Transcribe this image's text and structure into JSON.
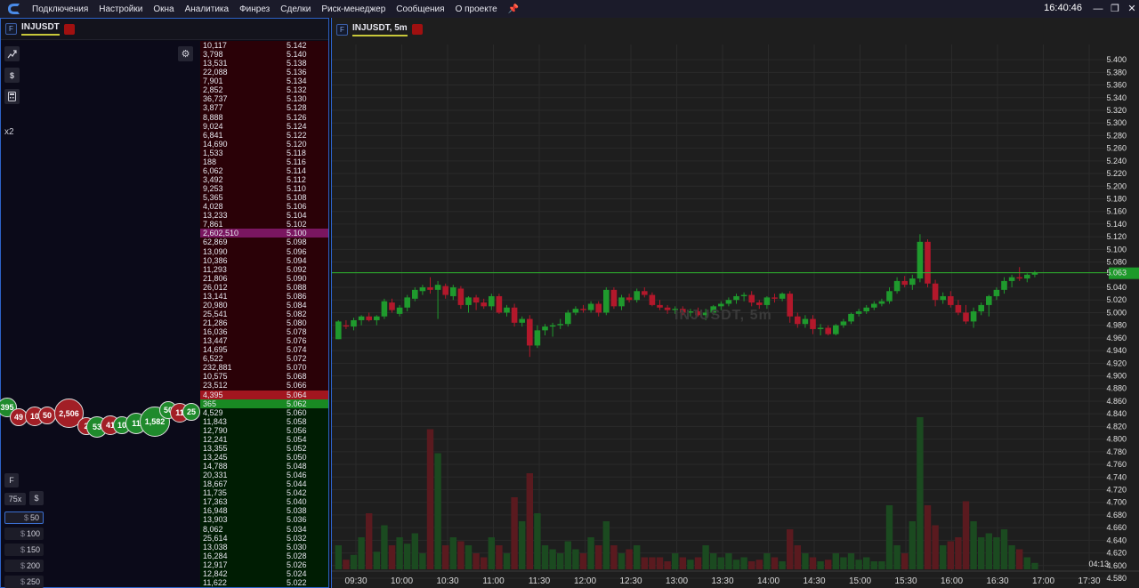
{
  "menubar": {
    "items": [
      "Подключения",
      "Настройки",
      "Окна",
      "Аналитика",
      "Финрез",
      "Сделки",
      "Риск-менеджер",
      "Сообщения",
      "О проекте"
    ],
    "clock": "16:40:46"
  },
  "left_panel": {
    "badge": "F",
    "symbol": "INJUSDT",
    "multiplier": "x2",
    "tools": [
      "chart-icon",
      "dollar-icon",
      "calculator-icon"
    ],
    "bubbles": [
      {
        "label": "395",
        "side": "buy"
      },
      {
        "label": "49",
        "side": "sell"
      },
      {
        "label": "10",
        "side": "sell"
      },
      {
        "label": "50",
        "side": "sell"
      },
      {
        "label": "2,506",
        "side": "sell"
      },
      {
        "label": "2",
        "side": "sell"
      },
      {
        "label": "53",
        "side": "buy"
      },
      {
        "label": "41",
        "side": "sell"
      },
      {
        "label": "10",
        "side": "buy"
      },
      {
        "label": "11",
        "side": "buy"
      },
      {
        "label": "1,582",
        "side": "buy"
      },
      {
        "label": "50",
        "side": "buy"
      },
      {
        "label": "11",
        "side": "sell"
      },
      {
        "label": "25",
        "side": "buy"
      }
    ],
    "bottom": {
      "f_label": "F",
      "leverage": "75x",
      "currency": "$",
      "amounts": [
        "50",
        "100",
        "150",
        "200",
        "250"
      ],
      "selected_amount": "50"
    }
  },
  "order_book": {
    "rows": [
      {
        "vol": "10,117",
        "price": "5.142",
        "side": "ask"
      },
      {
        "vol": "3,798",
        "price": "5.140",
        "side": "ask"
      },
      {
        "vol": "13,531",
        "price": "5.138",
        "side": "ask"
      },
      {
        "vol": "22,088",
        "price": "5.136",
        "side": "ask"
      },
      {
        "vol": "7,901",
        "price": "5.134",
        "side": "ask"
      },
      {
        "vol": "2,852",
        "price": "5.132",
        "side": "ask"
      },
      {
        "vol": "36,737",
        "price": "5.130",
        "side": "ask"
      },
      {
        "vol": "3,877",
        "price": "5.128",
        "side": "ask"
      },
      {
        "vol": "8,888",
        "price": "5.126",
        "side": "ask"
      },
      {
        "vol": "9,024",
        "price": "5.124",
        "side": "ask"
      },
      {
        "vol": "6,841",
        "price": "5.122",
        "side": "ask"
      },
      {
        "vol": "14,690",
        "price": "5.120",
        "side": "ask"
      },
      {
        "vol": "1,533",
        "price": "5.118",
        "side": "ask"
      },
      {
        "vol": "188",
        "price": "5.116",
        "side": "ask"
      },
      {
        "vol": "6,062",
        "price": "5.114",
        "side": "ask"
      },
      {
        "vol": "3,492",
        "price": "5.112",
        "side": "ask"
      },
      {
        "vol": "9,253",
        "price": "5.110",
        "side": "ask"
      },
      {
        "vol": "5,365",
        "price": "5.108",
        "side": "ask"
      },
      {
        "vol": "4,028",
        "price": "5.106",
        "side": "ask"
      },
      {
        "vol": "13,233",
        "price": "5.104",
        "side": "ask"
      },
      {
        "vol": "7,861",
        "price": "5.102",
        "side": "ask"
      },
      {
        "vol": "2,602,510",
        "price": "5.100",
        "side": "ask",
        "highlight": "large"
      },
      {
        "vol": "62,869",
        "price": "5.098",
        "side": "ask"
      },
      {
        "vol": "13,090",
        "price": "5.096",
        "side": "ask"
      },
      {
        "vol": "10,386",
        "price": "5.094",
        "side": "ask"
      },
      {
        "vol": "11,293",
        "price": "5.092",
        "side": "ask"
      },
      {
        "vol": "21,806",
        "price": "5.090",
        "side": "ask"
      },
      {
        "vol": "26,012",
        "price": "5.088",
        "side": "ask"
      },
      {
        "vol": "13,141",
        "price": "5.086",
        "side": "ask"
      },
      {
        "vol": "20,980",
        "price": "5.084",
        "side": "ask"
      },
      {
        "vol": "25,541",
        "price": "5.082",
        "side": "ask"
      },
      {
        "vol": "21,286",
        "price": "5.080",
        "side": "ask"
      },
      {
        "vol": "16,036",
        "price": "5.078",
        "side": "ask"
      },
      {
        "vol": "13,447",
        "price": "5.076",
        "side": "ask"
      },
      {
        "vol": "14,695",
        "price": "5.074",
        "side": "ask"
      },
      {
        "vol": "6,522",
        "price": "5.072",
        "side": "ask"
      },
      {
        "vol": "232,881",
        "price": "5.070",
        "side": "ask"
      },
      {
        "vol": "10,575",
        "price": "5.068",
        "side": "ask"
      },
      {
        "vol": "23,512",
        "price": "5.066",
        "side": "ask"
      },
      {
        "vol": "4,395",
        "price": "5.064",
        "side": "best-ask"
      },
      {
        "vol": "365",
        "price": "5.062",
        "side": "best-bid"
      },
      {
        "vol": "4,529",
        "price": "5.060",
        "side": "bid"
      },
      {
        "vol": "11,843",
        "price": "5.058",
        "side": "bid"
      },
      {
        "vol": "12,790",
        "price": "5.056",
        "side": "bid"
      },
      {
        "vol": "12,241",
        "price": "5.054",
        "side": "bid"
      },
      {
        "vol": "13,355",
        "price": "5.052",
        "side": "bid"
      },
      {
        "vol": "13,245",
        "price": "5.050",
        "side": "bid"
      },
      {
        "vol": "14,788",
        "price": "5.048",
        "side": "bid"
      },
      {
        "vol": "20,331",
        "price": "5.046",
        "side": "bid"
      },
      {
        "vol": "18,667",
        "price": "5.044",
        "side": "bid"
      },
      {
        "vol": "11,735",
        "price": "5.042",
        "side": "bid"
      },
      {
        "vol": "17,363",
        "price": "5.040",
        "side": "bid"
      },
      {
        "vol": "16,948",
        "price": "5.038",
        "side": "bid"
      },
      {
        "vol": "13,903",
        "price": "5.036",
        "side": "bid"
      },
      {
        "vol": "8,062",
        "price": "5.034",
        "side": "bid"
      },
      {
        "vol": "25,614",
        "price": "5.032",
        "side": "bid"
      },
      {
        "vol": "13,038",
        "price": "5.030",
        "side": "bid"
      },
      {
        "vol": "16,284",
        "price": "5.028",
        "side": "bid"
      },
      {
        "vol": "12,917",
        "price": "5.026",
        "side": "bid"
      },
      {
        "vol": "12,842",
        "price": "5.024",
        "side": "bid"
      },
      {
        "vol": "11,622",
        "price": "5.022",
        "side": "bid"
      }
    ]
  },
  "chart_panel": {
    "badge": "F",
    "title": "INJUSDT, 5m",
    "watermark": "INJUSDT, 5m",
    "last_price": "5.063",
    "countdown": "04:13",
    "colors": {
      "up": "#1f9a2d",
      "down": "#b2182b",
      "background": "#1e1e1e",
      "last_price_line": "#2eb82e"
    }
  },
  "chart_data": {
    "type": "candlestick",
    "symbol": "INJUSDT",
    "interval": "5m",
    "y_ticks": [
      "5.400",
      "5.380",
      "5.360",
      "5.340",
      "5.320",
      "5.300",
      "5.280",
      "5.260",
      "5.240",
      "5.220",
      "5.200",
      "5.180",
      "5.160",
      "5.140",
      "5.120",
      "5.100",
      "5.080",
      "5.063",
      "5.040",
      "5.020",
      "5.000",
      "4.980",
      "4.960",
      "4.940",
      "4.920",
      "4.900",
      "4.880",
      "4.860",
      "4.840",
      "4.820",
      "4.800",
      "4.780",
      "4.760",
      "4.740",
      "4.720",
      "4.700",
      "4.680",
      "4.660",
      "4.640",
      "4.620",
      "4.600",
      "4.580"
    ],
    "x_ticks": [
      "09:30",
      "10:00",
      "10:30",
      "11:00",
      "11:30",
      "12:00",
      "12:30",
      "13:00",
      "13:30",
      "14:00",
      "14:30",
      "15:00",
      "15:30",
      "16:00",
      "16:30",
      "17:00",
      "17:30"
    ],
    "price_range": [
      4.58,
      5.41
    ],
    "candles": [
      [
        4.958,
        4.988,
        4.958,
        4.986,
        30
      ],
      [
        4.98,
        4.988,
        4.974,
        4.978,
        12
      ],
      [
        4.978,
        4.992,
        4.972,
        4.988,
        18
      ],
      [
        4.988,
        4.996,
        4.98,
        4.994,
        40
      ],
      [
        4.994,
        5.0,
        4.986,
        4.988,
        70
      ],
      [
        4.988,
        4.996,
        4.98,
        4.994,
        22
      ],
      [
        4.994,
        5.022,
        4.99,
        5.018,
        55
      ],
      [
        5.016,
        5.022,
        5.0,
        5.004,
        30
      ],
      [
        4.998,
        5.012,
        4.994,
        5.008,
        40
      ],
      [
        5.008,
        5.028,
        5.002,
        5.024,
        32
      ],
      [
        5.022,
        5.04,
        5.018,
        5.036,
        45
      ],
      [
        5.034,
        5.044,
        5.028,
        5.04,
        20
      ],
      [
        5.04,
        5.056,
        5.03,
        5.036,
        175
      ],
      [
        5.036,
        5.05,
        4.99,
        5.044,
        145
      ],
      [
        5.042,
        5.046,
        5.022,
        5.028,
        30
      ],
      [
        5.026,
        5.044,
        5.02,
        5.04,
        40
      ],
      [
        5.038,
        5.042,
        5.006,
        5.012,
        35
      ],
      [
        5.012,
        5.026,
        5.0,
        5.024,
        30
      ],
      [
        5.024,
        5.028,
        5.004,
        5.016,
        20
      ],
      [
        5.016,
        5.022,
        5.006,
        5.01,
        15
      ],
      [
        5.01,
        5.03,
        5.004,
        5.026,
        40
      ],
      [
        5.026,
        5.03,
        4.998,
        5.0,
        30
      ],
      [
        5.0,
        5.012,
        4.994,
        5.008,
        20
      ],
      [
        5.008,
        5.014,
        4.978,
        4.984,
        90
      ],
      [
        4.984,
        4.994,
        4.978,
        4.99,
        60
      ],
      [
        4.99,
        4.996,
        4.93,
        4.948,
        120
      ],
      [
        4.948,
        4.98,
        4.944,
        4.972,
        70
      ],
      [
        4.972,
        4.982,
        4.964,
        4.978,
        30
      ],
      [
        4.978,
        4.984,
        4.962,
        4.98,
        25
      ],
      [
        4.98,
        4.99,
        4.974,
        4.982,
        20
      ],
      [
        4.982,
        5.004,
        4.978,
        5.0,
        35
      ],
      [
        5.0,
        5.01,
        4.996,
        5.006,
        25
      ],
      [
        5.006,
        5.012,
        5.0,
        5.004,
        20
      ],
      [
        5.004,
        5.018,
        5.0,
        5.014,
        40
      ],
      [
        5.014,
        5.018,
        4.994,
        5.0,
        30
      ],
      [
        5.0,
        5.04,
        4.996,
        5.036,
        60
      ],
      [
        5.036,
        5.04,
        5.006,
        5.01,
        30
      ],
      [
        5.01,
        5.028,
        5.004,
        5.024,
        20
      ],
      [
        5.024,
        5.03,
        5.016,
        5.02,
        25
      ],
      [
        5.02,
        5.038,
        5.016,
        5.034,
        30
      ],
      [
        5.034,
        5.04,
        5.024,
        5.028,
        15
      ],
      [
        5.028,
        5.032,
        5.01,
        5.012,
        15
      ],
      [
        5.012,
        5.02,
        5.004,
        5.008,
        15
      ],
      [
        5.008,
        5.012,
        4.998,
        5.004,
        10
      ],
      [
        5.004,
        5.01,
        4.998,
        5.006,
        20
      ],
      [
        5.006,
        5.01,
        4.996,
        5.0,
        15
      ],
      [
        5.0,
        5.006,
        4.994,
        5.002,
        12
      ],
      [
        5.002,
        5.008,
        4.994,
        4.996,
        15
      ],
      [
        4.996,
        5.006,
        4.988,
        5.0,
        30
      ],
      [
        5.0,
        5.012,
        4.996,
        5.01,
        20
      ],
      [
        5.01,
        5.018,
        5.004,
        5.014,
        15
      ],
      [
        5.014,
        5.024,
        5.01,
        5.02,
        20
      ],
      [
        5.02,
        5.03,
        5.014,
        5.026,
        12
      ],
      [
        5.026,
        5.032,
        5.018,
        5.028,
        15
      ],
      [
        5.028,
        5.034,
        5.01,
        5.016,
        10
      ],
      [
        5.016,
        5.02,
        5.006,
        5.012,
        12
      ],
      [
        5.012,
        5.026,
        5.006,
        5.024,
        20
      ],
      [
        5.024,
        5.03,
        5.016,
        5.022,
        15
      ],
      [
        5.022,
        5.032,
        5.018,
        5.03,
        10
      ],
      [
        5.03,
        5.034,
        4.984,
        4.994,
        50
      ],
      [
        4.994,
        5.0,
        4.976,
        4.982,
        30
      ],
      [
        4.982,
        4.996,
        4.976,
        4.99,
        20
      ],
      [
        4.99,
        4.996,
        4.966,
        4.974,
        15
      ],
      [
        4.974,
        4.982,
        4.964,
        4.976,
        10
      ],
      [
        4.976,
        4.98,
        4.964,
        4.966,
        12
      ],
      [
        4.966,
        4.982,
        4.964,
        4.98,
        20
      ],
      [
        4.98,
        4.99,
        4.976,
        4.986,
        15
      ],
      [
        4.986,
        5.0,
        4.982,
        4.998,
        20
      ],
      [
        4.998,
        5.006,
        4.994,
        5.002,
        12
      ],
      [
        5.002,
        5.012,
        4.998,
        5.008,
        15
      ],
      [
        5.008,
        5.018,
        5.004,
        5.014,
        10
      ],
      [
        5.014,
        5.022,
        5.01,
        5.018,
        10
      ],
      [
        5.018,
        5.04,
        5.014,
        5.034,
        80
      ],
      [
        5.034,
        5.056,
        5.03,
        5.05,
        30
      ],
      [
        5.05,
        5.058,
        5.04,
        5.044,
        20
      ],
      [
        5.044,
        5.06,
        5.036,
        5.054,
        60
      ],
      [
        5.054,
        5.124,
        5.048,
        5.112,
        190
      ],
      [
        5.112,
        5.116,
        5.04,
        5.046,
        80
      ],
      [
        5.046,
        5.052,
        5.01,
        5.02,
        55
      ],
      [
        5.02,
        5.032,
        5.014,
        5.026,
        30
      ],
      [
        5.026,
        5.034,
        5.008,
        5.012,
        35
      ],
      [
        5.012,
        5.02,
        4.996,
        5.0,
        40
      ],
      [
        5.0,
        5.012,
        4.982,
        4.986,
        85
      ],
      [
        4.986,
        5.008,
        4.976,
        5.002,
        60
      ],
      [
        5.002,
        5.016,
        4.996,
        5.012,
        40
      ],
      [
        5.012,
        5.028,
        4.994,
        5.026,
        45
      ],
      [
        5.026,
        5.04,
        5.02,
        5.036,
        40
      ],
      [
        5.036,
        5.056,
        5.03,
        5.05,
        50
      ],
      [
        5.05,
        5.06,
        5.04,
        5.056,
        30
      ],
      [
        5.056,
        5.072,
        5.05,
        5.054,
        25
      ],
      [
        5.054,
        5.062,
        5.048,
        5.06,
        15
      ],
      [
        5.06,
        5.066,
        5.056,
        5.063,
        8
      ]
    ]
  }
}
